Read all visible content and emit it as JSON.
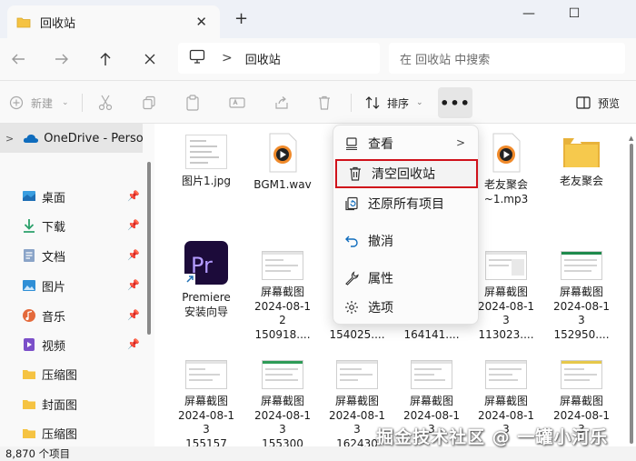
{
  "window": {
    "tab_title": "回收站",
    "new_tab_glyph": "+",
    "close_tab_glyph": "✕",
    "controls": {
      "minimize": "—",
      "maximize": "☐"
    }
  },
  "addressbar": {
    "breadcrumb_item": "回收站",
    "breadcrumb_sep": ">",
    "search_placeholder": "在 回收站 中搜索"
  },
  "toolbar": {
    "new_label": "新建",
    "sort_label": "排序",
    "more_glyph": "•••",
    "preview_label": "预览"
  },
  "sidebar": {
    "onedrive_label": "OneDrive - Personal",
    "items": [
      {
        "label": "桌面",
        "icon": "desktop-icon",
        "pinned": true
      },
      {
        "label": "下载",
        "icon": "download-icon",
        "pinned": true
      },
      {
        "label": "文档",
        "icon": "documents-icon",
        "pinned": true
      },
      {
        "label": "图片",
        "icon": "pictures-icon",
        "pinned": true
      },
      {
        "label": "音乐",
        "icon": "music-icon",
        "pinned": true
      },
      {
        "label": "视频",
        "icon": "videos-icon",
        "pinned": true
      },
      {
        "label": "压缩图",
        "icon": "folder-icon",
        "pinned": false
      },
      {
        "label": "封面图",
        "icon": "folder-icon",
        "pinned": false
      },
      {
        "label": "压缩图",
        "icon": "folder-icon",
        "pinned": false
      }
    ]
  },
  "files": {
    "row1": [
      {
        "line1": "图片1.jpg"
      },
      {
        "line1": "BGM1.wav"
      },
      {
        "line1": "老友聚会",
        "line2": "~1.mp3"
      },
      {
        "line1": "老友聚会"
      }
    ],
    "row2": [
      {
        "line1": "Premiere",
        "line2": "安装向导"
      },
      {
        "line1": "屏幕截图",
        "line2": "2024-08-1",
        "line3": "2",
        "line4": "150918...."
      },
      {
        "line4": "154025...."
      },
      {
        "line4": "164141...."
      },
      {
        "line1": "屏幕截图",
        "line2": "2024-08-1",
        "line3": "3",
        "line4": "113023...."
      },
      {
        "line1": "屏幕截图",
        "line2": "2024-08-1",
        "line3": "3",
        "line4": "152950...."
      }
    ],
    "row3": [
      {
        "line1": "屏幕截图",
        "line2": "2024-08-1",
        "line3": "3",
        "line4": "155157"
      },
      {
        "line1": "屏幕截图",
        "line2": "2024-08-1",
        "line3": "3",
        "line4": "155300"
      },
      {
        "line1": "屏幕截图",
        "line2": "2024-08-1",
        "line3": "3",
        "line4": "162430"
      },
      {
        "line1": "屏幕截图",
        "line2": "2024-08-1",
        "line3": "3"
      },
      {
        "line1": "屏幕截图",
        "line2": "2024-08-1",
        "line3": "3"
      },
      {
        "line1": "屏幕截图",
        "line2": "2024-08-1",
        "line3": "3"
      }
    ]
  },
  "context_menu": {
    "items": [
      {
        "label": "查看",
        "icon": "view-icon",
        "submenu": true
      },
      {
        "label": "清空回收站",
        "icon": "trash-icon",
        "highlighted": true
      },
      {
        "label": "还原所有项目",
        "icon": "restore-icon"
      },
      {
        "label": "撤消",
        "icon": "undo-icon"
      },
      {
        "label": "属性",
        "icon": "wrench-icon"
      },
      {
        "label": "选项",
        "icon": "settings-icon"
      }
    ],
    "submenu_arrow": ">"
  },
  "status": {
    "item_count": "8,870 个项目"
  },
  "watermark": {
    "text": "掘金技术社区 @ 一罐小河乐"
  },
  "colors": {
    "highlight_border": "#d0111a",
    "accent_blue": "#0f6cbd",
    "folder_yellow": "#f5c342"
  }
}
